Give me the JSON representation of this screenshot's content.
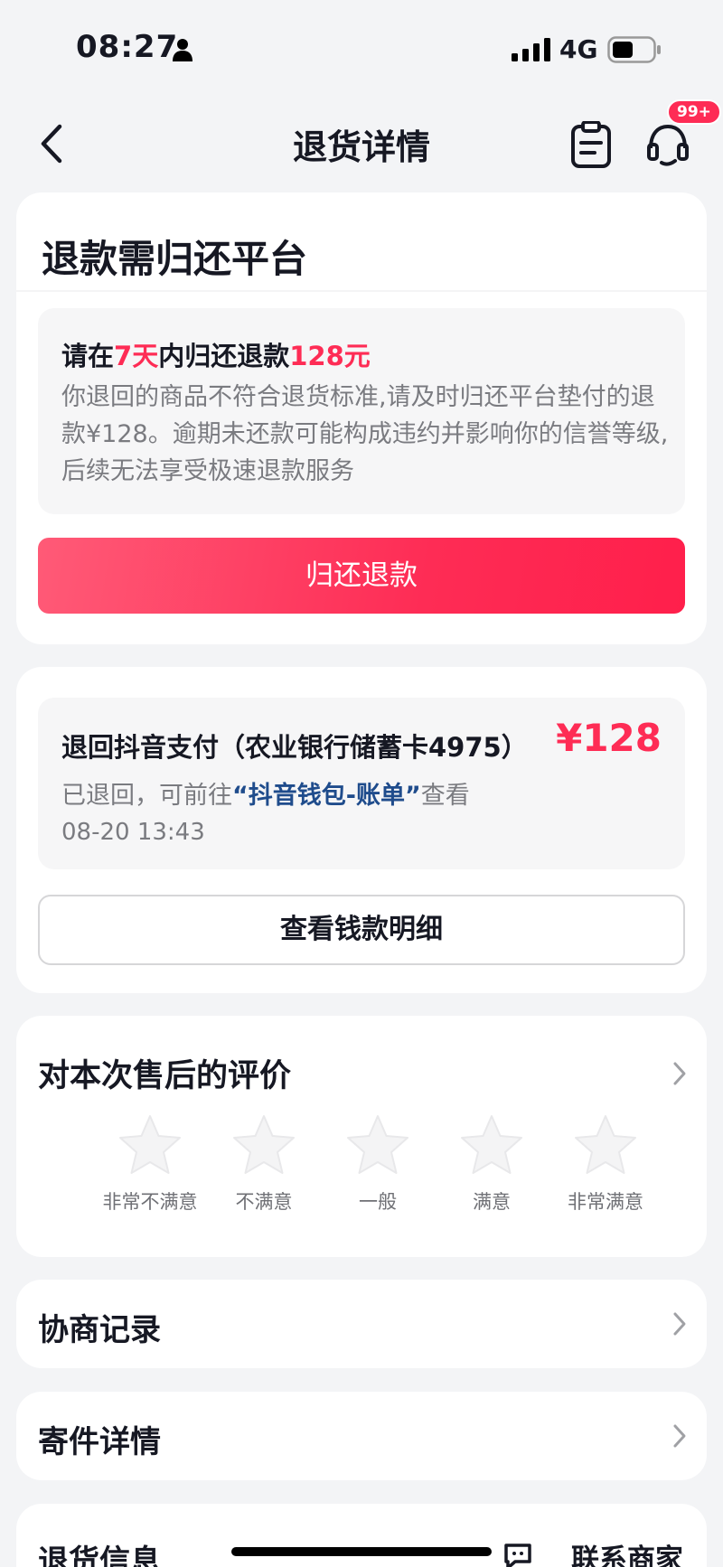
{
  "status_bar": {
    "time": "08:27",
    "network": "4G",
    "icons": [
      "person-icon",
      "signal-icon",
      "battery-icon"
    ]
  },
  "nav": {
    "title": "退货详情",
    "badge": "99+",
    "icons": [
      "back-icon",
      "orders-icon",
      "customer-service-icon"
    ]
  },
  "refund_notice": {
    "title": "退款需归还平台",
    "line_prefix": "请在",
    "days": "7天",
    "line_middle": "内归还退款",
    "amount": "128元",
    "description": "你退回的商品不符合退货标准,请及时归还平台垫付的退款¥128。逾期未还款可能构成违约并影响你的信誉等级,后续无法享受极速退款服务",
    "button": "归还退款"
  },
  "refund_record": {
    "destination": "退回抖音支付（农业银行储蓄卡4975）",
    "amount": "¥128",
    "status_prefix": "已退回，可前往",
    "status_link": "“抖音钱包-账单”",
    "status_suffix": "查看",
    "time": "08-20 13:43",
    "button": "查看钱款明细"
  },
  "rating": {
    "title": "对本次售后的评价",
    "options": [
      "非常不满意",
      "不满意",
      "一般",
      "满意",
      "非常满意"
    ]
  },
  "rows": {
    "negotiation": "协商记录",
    "shipping": "寄件详情"
  },
  "return_info": {
    "title": "退货信息",
    "contact": "联系商家"
  },
  "colors": {
    "accent": "#fe2c55",
    "link": "#1f4c8c",
    "background": "#f3f4f6"
  }
}
